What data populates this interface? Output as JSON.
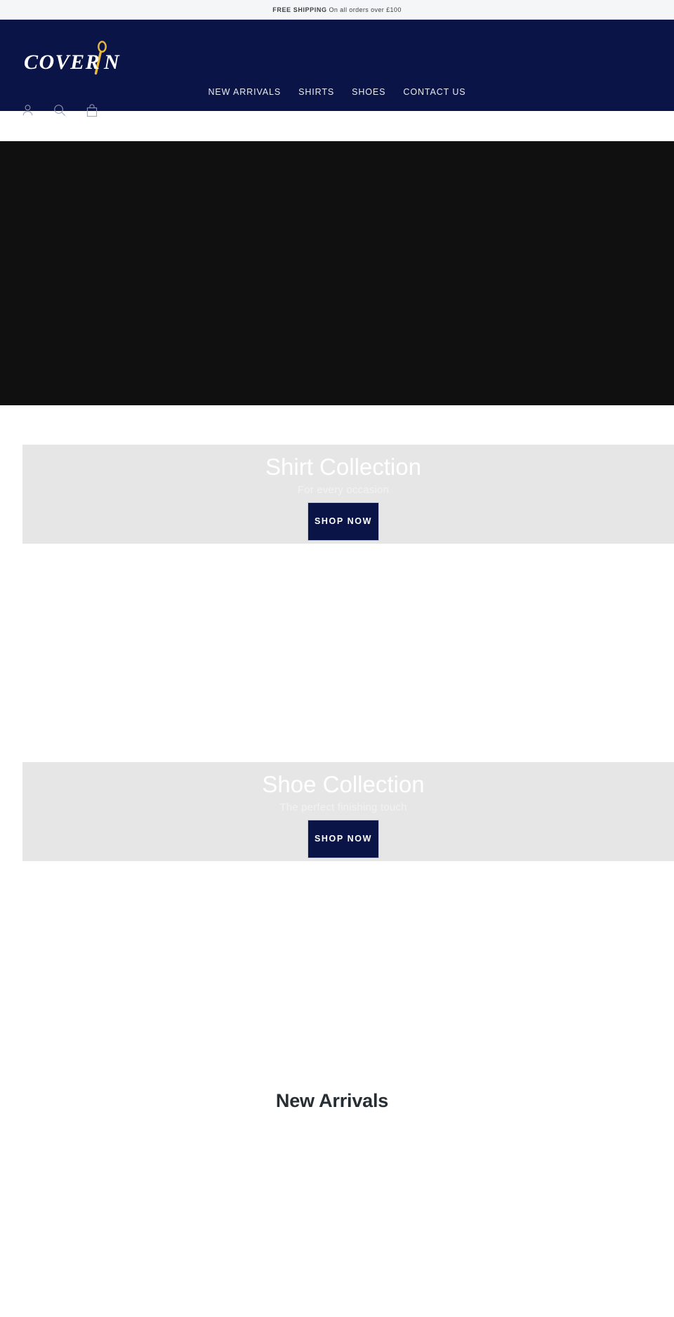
{
  "announcement": {
    "strong": "FREE SHIPPING",
    "rest": " On all orders over £100"
  },
  "brand": {
    "name": "COVERIN",
    "logo_word": "COVERIN",
    "logo_accent_color": "#e8b93f",
    "logo_text_color": "#ffffff",
    "header_bg": "#0b1446"
  },
  "nav": {
    "items": [
      {
        "label": "NEW ARRIVALS",
        "name": "nav-link-new-arrivals"
      },
      {
        "label": "SHIRTS",
        "name": "nav-link-shirts"
      },
      {
        "label": "SHOES",
        "name": "nav-link-shoes"
      },
      {
        "label": "CONTACT US",
        "name": "nav-link-contact-us"
      }
    ]
  },
  "header_icons": [
    {
      "icon": "account-icon",
      "label": "Account"
    },
    {
      "icon": "search-icon",
      "label": "Search"
    },
    {
      "icon": "cart-icon",
      "label": "Cart"
    }
  ],
  "hero": {
    "background_color": "#101010"
  },
  "collections": [
    {
      "title": "Shirt Collection",
      "subtitle": "For every occasion",
      "cta": "SHOP NOW",
      "card_bg": "#e6e6e6",
      "cta_bg": "#0b1446"
    },
    {
      "title": "Shoe Collection",
      "subtitle": "The perfect finishing touch",
      "cta": "SHOP NOW",
      "card_bg": "#e6e6e6",
      "cta_bg": "#0b1446"
    }
  ],
  "new_arrivals": {
    "heading": "New Arrivals"
  }
}
